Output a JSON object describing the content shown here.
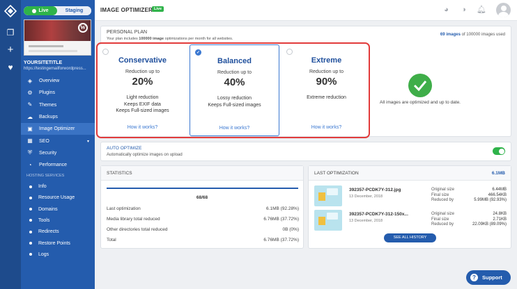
{
  "env": {
    "live": "Live",
    "staging": "Staging"
  },
  "site": {
    "title": "YOURSITETITLE",
    "url": "https://testingemailforwordpress..."
  },
  "nav": [
    {
      "label": "Overview",
      "icon": "layers-icon"
    },
    {
      "label": "Plugins",
      "icon": "plugin-icon"
    },
    {
      "label": "Themes",
      "icon": "brush-icon"
    },
    {
      "label": "Backups",
      "icon": "cloud-icon"
    },
    {
      "label": "Image Optimizer",
      "icon": "image-icon",
      "active": true
    },
    {
      "label": "SEO",
      "icon": "chart-icon"
    },
    {
      "label": "Security",
      "icon": "shield-icon"
    },
    {
      "label": "Performance",
      "icon": "speedometer-icon"
    }
  ],
  "hosting": {
    "heading": "HOSTING SERVICES",
    "items": [
      "Info",
      "Resource Usage",
      "Domains",
      "Tools",
      "Redirects",
      "Restore Points",
      "Logs"
    ]
  },
  "topbar": {
    "title": "IMAGE OPTIMIZER",
    "badge": "Live"
  },
  "plan": {
    "heading": "PERSONAL PLAN",
    "desc_pre": "Your plan includes ",
    "desc_bold": "100000 image",
    "desc_post": " optimizations per month for all websites.",
    "used_bold": "69 images",
    "used_rest": " of 100000 images used"
  },
  "levels": [
    {
      "name": "Conservative",
      "reduction_label": "Reduction up to",
      "percent": "20%",
      "features": [
        "Light reduction",
        "Keeps EXIF data",
        "Keeps Full-sized images"
      ],
      "link": "How it works?"
    },
    {
      "name": "Balanced",
      "reduction_label": "Reduction up to",
      "percent": "40%",
      "features": [
        "Lossy reduction",
        "Keeps Full-sized images"
      ],
      "link": "How it works?",
      "selected": true
    },
    {
      "name": "Extreme",
      "reduction_label": "Reduction up to",
      "percent": "90%",
      "features": [
        "Extreme reduction"
      ],
      "link": "How it works?"
    }
  ],
  "status_msg": "All images are optimized and up to date.",
  "auto": {
    "title": "AUTO OPTIMIZE",
    "desc": "Automatically optimize images on upload",
    "enabled": true
  },
  "stats": {
    "heading": "STATISTICS",
    "progress": "68/68",
    "progress_fraction": 1.0,
    "rows": [
      {
        "label": "Last optimization",
        "value": "6.1MB (92.28%)"
      },
      {
        "label": "Media library total reduced",
        "value": "6.76MB (37.72%)"
      },
      {
        "label": "Other directories total reduced",
        "value": "0B (0%)"
      },
      {
        "label": "Total",
        "value": "6.76MB (37.72%)"
      }
    ]
  },
  "last": {
    "heading": "LAST OPTIMIZATION",
    "total": "6.1MB",
    "labels": [
      "Original size",
      "Final size",
      "Reduced by"
    ],
    "items": [
      {
        "name": "392357-PCDK7Y-312.jpg",
        "date": "13 December, 2018",
        "original": "6.44MB",
        "final": "466.54KB",
        "reduced": "5.99MB (92.93%)"
      },
      {
        "name": "392357-PCDK7Y-312-150x...",
        "date": "13 December, 2018",
        "original": "24.8KB",
        "final": "2.71KB",
        "reduced": "22.09KB (89.09%)"
      }
    ],
    "history_button": "SEE ALL HISTORY"
  },
  "support": "Support",
  "colors": {
    "primary": "#245cad",
    "rail": "#1e4b8c",
    "live_green": "#2fb34a",
    "highlight_red": "#e23b3b",
    "link_blue": "#3b78d1"
  }
}
